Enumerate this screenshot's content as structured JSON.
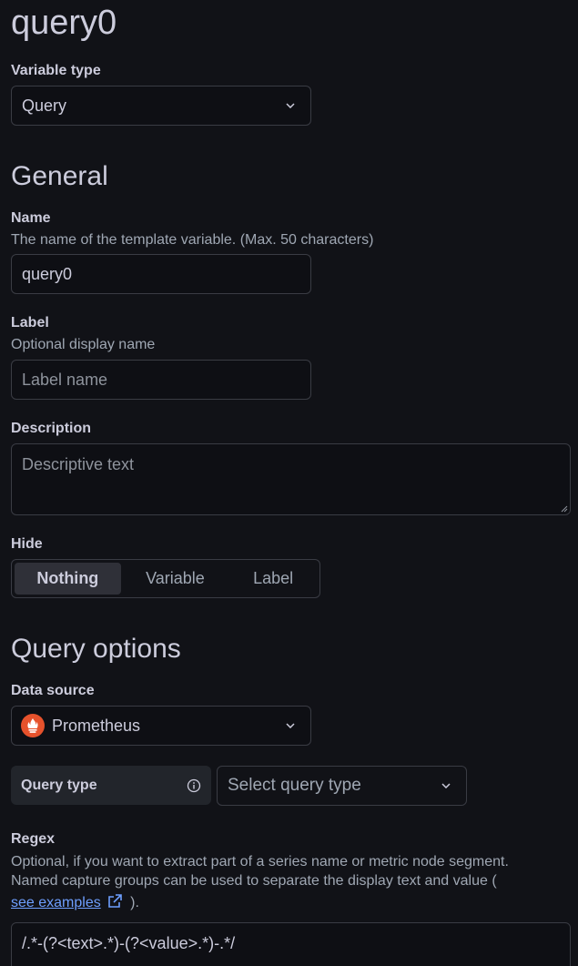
{
  "title": "query0",
  "variable_type": {
    "label": "Variable type",
    "value": "Query"
  },
  "general": {
    "heading": "General",
    "name": {
      "label": "Name",
      "description": "The name of the template variable. (Max. 50 characters)",
      "value": "query0"
    },
    "label_field": {
      "label": "Label",
      "description": "Optional display name",
      "placeholder": "Label name"
    },
    "description": {
      "label": "Description",
      "placeholder": "Descriptive text"
    },
    "hide": {
      "label": "Hide",
      "options": [
        "Nothing",
        "Variable",
        "Label"
      ],
      "selected": "Nothing"
    }
  },
  "query_options": {
    "heading": "Query options",
    "data_source": {
      "label": "Data source",
      "value": "Prometheus",
      "icon": "prometheus-icon",
      "icon_color": "#e6522c"
    },
    "query_type": {
      "label": "Query type",
      "placeholder": "Select query type",
      "info_icon": "info-icon"
    },
    "regex": {
      "label": "Regex",
      "description_line1": "Optional, if you want to extract part of a series name or metric node segment.",
      "description_line2": "Named capture groups can be used to separate the display text and value (",
      "link_text": "see examples",
      "description_end": ").",
      "value": "/.*-(?<text>.*)-(?<value>.*)-.*/"
    }
  },
  "colors": {
    "background": "#111217",
    "input_background": "#0e0f14",
    "border": "#3a3c44",
    "text": "#ccccdc",
    "muted": "#9fa7b3",
    "link": "#6e9fff"
  }
}
